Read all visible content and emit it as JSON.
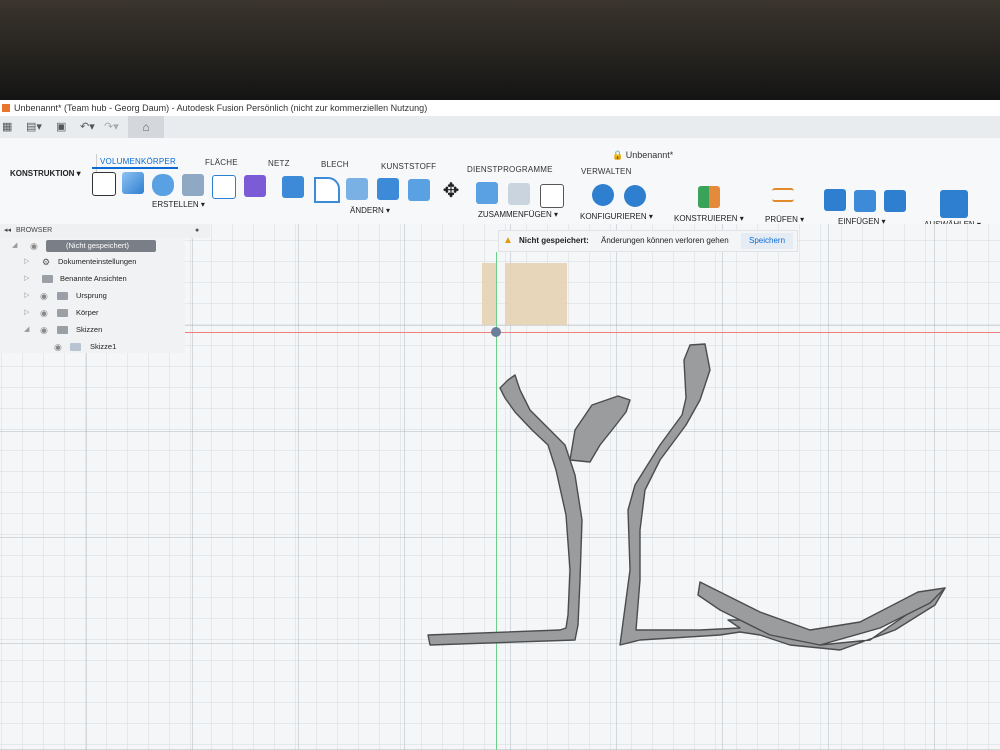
{
  "window_title": "Unbenannt* (Team hub - Georg Daum) - Autodesk Fusion Persönlich (nicht zur kommerziellen Nutzung)",
  "document_tab": "Unbenannt*",
  "workspace": "KONSTRUKTION",
  "tabs": [
    {
      "label": "VOLUMENKÖRPER",
      "active": true
    },
    {
      "label": "FLÄCHE"
    },
    {
      "label": "NETZ"
    },
    {
      "label": "BLECH"
    },
    {
      "label": "KUNSTSTOFF"
    },
    {
      "label": "DIENSTPROGRAMME"
    },
    {
      "label": "VERWALTEN"
    }
  ],
  "groups": [
    "ERSTELLEN ▾",
    "ÄNDERN ▾",
    "ZUSAMMENFÜGEN ▾",
    "KONFIGURIEREN ▾",
    "KONSTRUIEREN ▾",
    "PRÜFEN ▾",
    "EINFÜGEN ▾",
    "AUSWÄHLEN ▾"
  ],
  "browser": {
    "title": "BROWSER",
    "root": "(Nicht gespeichert)",
    "items": [
      "Dokumenteinstellungen",
      "Benannte Ansichten",
      "Ursprung",
      "Körper",
      "Skizzen",
      "Skizze1"
    ]
  },
  "warning": {
    "title": "Nicht gespeichert:",
    "message": "Änderungen können verloren gehen",
    "button": "Speichern"
  },
  "colors": {
    "accent": "#0a6bd6",
    "warning": "#e39b0e",
    "body_fill": "#9a9c9e"
  }
}
